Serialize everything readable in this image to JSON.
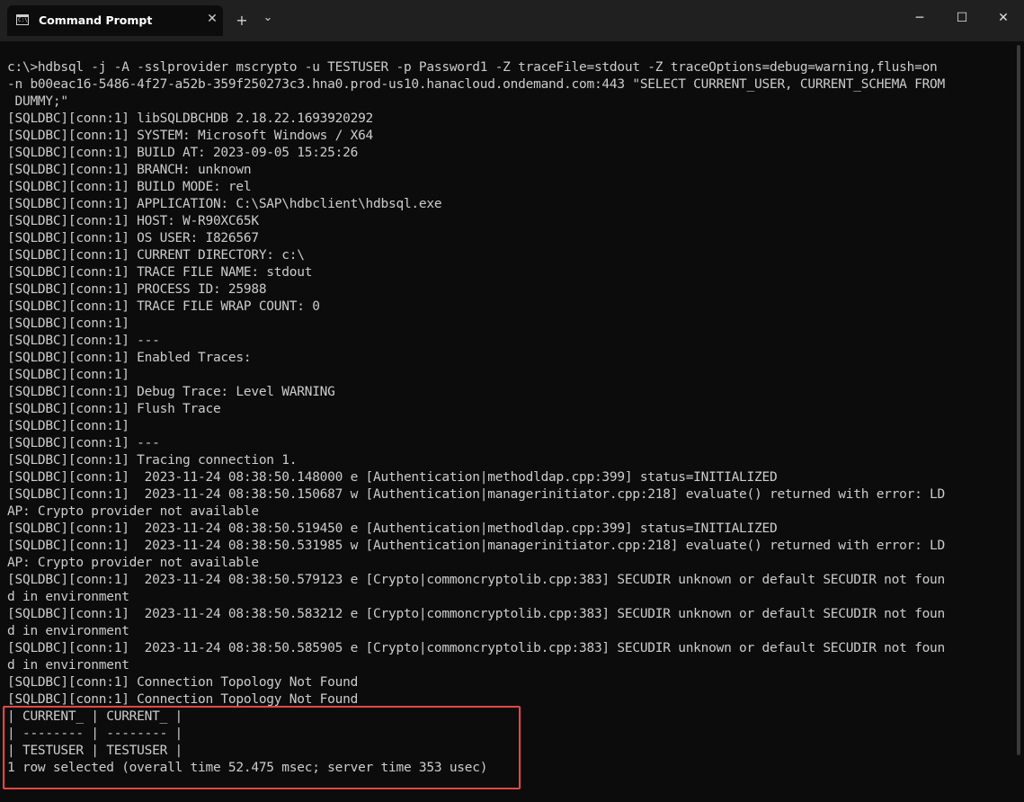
{
  "window": {
    "tab_title": "Command Prompt",
    "tab_icon": "C:\\",
    "close_tab": "✕",
    "new_tab": "+",
    "dropdown": "⌄",
    "minimize": "─",
    "maximize": "☐",
    "close": "✕"
  },
  "terminal": {
    "lines": [
      "c:\\>hdbsql -j -A -sslprovider mscrypto -u TESTUSER -p Password1 -Z traceFile=stdout -Z traceOptions=debug=warning,flush=on",
      "-n b00eac16-5486-4f27-a52b-359f250273c3.hna0.prod-us10.hanacloud.ondemand.com:443 \"SELECT CURRENT_USER, CURRENT_SCHEMA FROM",
      " DUMMY;\"",
      "[SQLDBC][conn:1] libSQLDBCHDB 2.18.22.1693920292",
      "[SQLDBC][conn:1] SYSTEM: Microsoft Windows / X64",
      "[SQLDBC][conn:1] BUILD AT: 2023-09-05 15:25:26",
      "[SQLDBC][conn:1] BRANCH: unknown",
      "[SQLDBC][conn:1] BUILD MODE: rel",
      "[SQLDBC][conn:1] APPLICATION: C:\\SAP\\hdbclient\\hdbsql.exe",
      "[SQLDBC][conn:1] HOST: W-R90XC65K",
      "[SQLDBC][conn:1] OS USER: I826567",
      "[SQLDBC][conn:1] CURRENT DIRECTORY: c:\\",
      "[SQLDBC][conn:1] TRACE FILE NAME: stdout",
      "[SQLDBC][conn:1] PROCESS ID: 25988",
      "[SQLDBC][conn:1] TRACE FILE WRAP COUNT: 0",
      "[SQLDBC][conn:1]",
      "[SQLDBC][conn:1] ---",
      "[SQLDBC][conn:1] Enabled Traces:",
      "[SQLDBC][conn:1]",
      "[SQLDBC][conn:1] Debug Trace: Level WARNING",
      "[SQLDBC][conn:1] Flush Trace",
      "[SQLDBC][conn:1]",
      "[SQLDBC][conn:1] ---",
      "[SQLDBC][conn:1] Tracing connection 1.",
      "[SQLDBC][conn:1]  2023-11-24 08:38:50.148000 e [Authentication|methodldap.cpp:399] status=INITIALIZED",
      "[SQLDBC][conn:1]  2023-11-24 08:38:50.150687 w [Authentication|managerinitiator.cpp:218] evaluate() returned with error: LD",
      "AP: Crypto provider not available",
      "[SQLDBC][conn:1]  2023-11-24 08:38:50.519450 e [Authentication|methodldap.cpp:399] status=INITIALIZED",
      "[SQLDBC][conn:1]  2023-11-24 08:38:50.531985 w [Authentication|managerinitiator.cpp:218] evaluate() returned with error: LD",
      "AP: Crypto provider not available",
      "[SQLDBC][conn:1]  2023-11-24 08:38:50.579123 e [Crypto|commoncryptolib.cpp:383] SECUDIR unknown or default SECUDIR not foun",
      "d in environment",
      "[SQLDBC][conn:1]  2023-11-24 08:38:50.583212 e [Crypto|commoncryptolib.cpp:383] SECUDIR unknown or default SECUDIR not foun",
      "d in environment",
      "[SQLDBC][conn:1]  2023-11-24 08:38:50.585905 e [Crypto|commoncryptolib.cpp:383] SECUDIR unknown or default SECUDIR not foun",
      "d in environment",
      "[SQLDBC][conn:1] Connection Topology Not Found",
      "[SQLDBC][conn:1] Connection Topology Not Found",
      "| CURRENT_ | CURRENT_ |",
      "| -------- | -------- |",
      "| TESTUSER | TESTUSER |",
      "1 row selected (overall time 52.475 msec; server time 353 usec)"
    ]
  }
}
